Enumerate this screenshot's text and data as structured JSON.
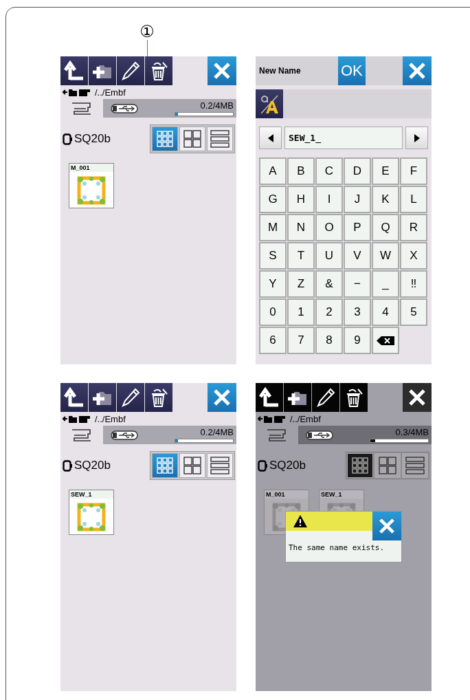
{
  "callout": {
    "label": "①"
  },
  "screens": [
    {
      "kind": "file_list",
      "dimmed": false,
      "path": "/../Embf",
      "storage_tabs": [
        {
          "kind": "machine",
          "selected": true
        },
        {
          "kind": "usb",
          "selected": false
        }
      ],
      "memory": {
        "reading": "0.2/4MB",
        "level": 0.05
      },
      "hoop": "SQ20b",
      "view_buttons": [
        {
          "kind": "small_grid",
          "selected": true
        },
        {
          "kind": "large_grid",
          "selected": false
        },
        {
          "kind": "list",
          "selected": false
        }
      ],
      "files": [
        {
          "name": "M_001"
        }
      ]
    },
    {
      "kind": "keyboard",
      "title": "New Name",
      "ok_label": "OK",
      "field": {
        "value": "SEW_1_"
      },
      "keys": [
        {
          "kind": "char",
          "label": "A"
        },
        {
          "kind": "char",
          "label": "B"
        },
        {
          "kind": "char",
          "label": "C"
        },
        {
          "kind": "char",
          "label": "D"
        },
        {
          "kind": "char",
          "label": "E"
        },
        {
          "kind": "char",
          "label": "F"
        },
        {
          "kind": "char",
          "label": "G"
        },
        {
          "kind": "char",
          "label": "H"
        },
        {
          "kind": "char",
          "label": "I"
        },
        {
          "kind": "char",
          "label": "J"
        },
        {
          "kind": "char",
          "label": "K"
        },
        {
          "kind": "char",
          "label": "L"
        },
        {
          "kind": "char",
          "label": "M"
        },
        {
          "kind": "char",
          "label": "N"
        },
        {
          "kind": "char",
          "label": "O"
        },
        {
          "kind": "char",
          "label": "P"
        },
        {
          "kind": "char",
          "label": "Q"
        },
        {
          "kind": "char",
          "label": "R"
        },
        {
          "kind": "char",
          "label": "S"
        },
        {
          "kind": "char",
          "label": "T"
        },
        {
          "kind": "char",
          "label": "U"
        },
        {
          "kind": "char",
          "label": "V"
        },
        {
          "kind": "char",
          "label": "W"
        },
        {
          "kind": "char",
          "label": "X"
        },
        {
          "kind": "char",
          "label": "Y"
        },
        {
          "kind": "char",
          "label": "Z"
        },
        {
          "kind": "char",
          "label": "&"
        },
        {
          "kind": "char",
          "label": "−"
        },
        {
          "kind": "char",
          "label": "_"
        },
        {
          "kind": "char",
          "label": "‼"
        },
        {
          "kind": "char",
          "label": "0"
        },
        {
          "kind": "char",
          "label": "1"
        },
        {
          "kind": "char",
          "label": "2"
        },
        {
          "kind": "char",
          "label": "3"
        },
        {
          "kind": "char",
          "label": "4"
        },
        {
          "kind": "char",
          "label": "5"
        },
        {
          "kind": "char",
          "label": "6"
        },
        {
          "kind": "char",
          "label": "7"
        },
        {
          "kind": "char",
          "label": "8"
        },
        {
          "kind": "char",
          "label": "9"
        },
        {
          "kind": "backspace"
        }
      ]
    },
    {
      "kind": "file_list",
      "dimmed": false,
      "path": "/../Embf",
      "storage_tabs": [
        {
          "kind": "machine",
          "selected": true
        },
        {
          "kind": "usb",
          "selected": false
        }
      ],
      "memory": {
        "reading": "0.2/4MB",
        "level": 0.05
      },
      "hoop": "SQ20b",
      "view_buttons": [
        {
          "kind": "small_grid",
          "selected": true
        },
        {
          "kind": "large_grid",
          "selected": false
        },
        {
          "kind": "list",
          "selected": false
        }
      ],
      "files": [
        {
          "name": "SEW_1"
        }
      ]
    },
    {
      "kind": "file_list",
      "dimmed": true,
      "path": "/../Embf",
      "storage_tabs": [
        {
          "kind": "machine",
          "selected": true
        },
        {
          "kind": "usb",
          "selected": false
        }
      ],
      "memory": {
        "reading": "0.3/4MB",
        "level": 0.08
      },
      "hoop": "SQ20b",
      "view_buttons": [
        {
          "kind": "small_grid",
          "selected": true
        },
        {
          "kind": "large_grid",
          "selected": false
        },
        {
          "kind": "list",
          "selected": false
        }
      ],
      "files": [
        {
          "name": "M_001"
        },
        {
          "name": "SEW_1"
        }
      ],
      "dialog": {
        "message": "The same name exists."
      }
    }
  ]
}
